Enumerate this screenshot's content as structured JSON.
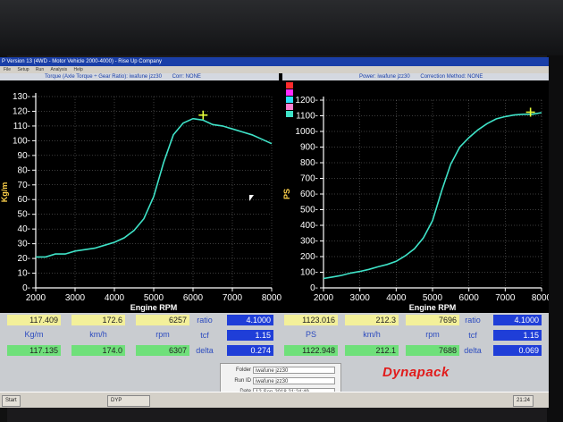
{
  "window": {
    "title": "P Version 13 (4WD - Motor Vehicle 2000-4000) - Rise Up Company",
    "menu": [
      "File",
      "Setup",
      "Run",
      "Analysis",
      "Help"
    ]
  },
  "left_header": {
    "title": "Torque (Axle Torque ÷ Gear Ratio): iwafune jzz30",
    "corr": "Corr: NONE"
  },
  "right_header": {
    "title": "Power: iwafune jzz30",
    "corr": "Correction Method: NONE"
  },
  "chart_data": [
    {
      "type": "line",
      "xlabel": "Engine RPM",
      "ylabel": "Kg/m",
      "xlim": [
        2000,
        8000
      ],
      "ylim": [
        0,
        130
      ],
      "x_ticks": [
        2000,
        3000,
        4000,
        5000,
        6000,
        7000,
        8000
      ],
      "y_ticks": [
        0,
        10,
        20,
        30,
        40,
        50,
        60,
        70,
        80,
        90,
        100,
        110,
        120,
        130
      ],
      "grid": true,
      "series": [
        {
          "color": "#3fe3c8",
          "x": [
            2000,
            2250,
            2500,
            2750,
            3000,
            3250,
            3500,
            3750,
            4000,
            4250,
            4500,
            4750,
            5000,
            5250,
            5500,
            5750,
            6000,
            6250,
            6500,
            6750,
            7000,
            7250,
            7500,
            7750,
            8000
          ],
          "y": [
            21,
            21,
            23,
            23,
            25,
            26,
            27,
            29,
            31,
            34,
            39,
            47,
            62,
            85,
            104,
            112,
            115,
            114,
            111,
            110,
            108,
            106,
            104,
            101,
            98
          ]
        }
      ],
      "marker": {
        "x": 6257,
        "y": 117.4
      }
    },
    {
      "type": "line",
      "xlabel": "Engine RPM",
      "ylabel": "PS",
      "xlim": [
        2000,
        8000
      ],
      "ylim": [
        0,
        1200
      ],
      "x_ticks": [
        2000,
        3000,
        4000,
        5000,
        6000,
        7000,
        8000
      ],
      "y_ticks": [
        0,
        100,
        200,
        300,
        400,
        500,
        600,
        700,
        800,
        900,
        1000,
        1100,
        1200
      ],
      "grid": true,
      "series": [
        {
          "color": "#3fe3c8",
          "x": [
            2000,
            2250,
            2500,
            2750,
            3000,
            3250,
            3500,
            3750,
            4000,
            4250,
            4500,
            4750,
            5000,
            5250,
            5500,
            5750,
            6000,
            6250,
            6500,
            6750,
            7000,
            7250,
            7500,
            7750,
            8000
          ],
          "y": [
            60,
            70,
            80,
            95,
            105,
            118,
            135,
            150,
            170,
            205,
            250,
            320,
            430,
            620,
            790,
            900,
            960,
            1010,
            1050,
            1080,
            1095,
            1105,
            1110,
            1110,
            1120
          ]
        }
      ],
      "marker": {
        "x": 7696,
        "y": 1123
      }
    }
  ],
  "left_panel": {
    "row1": [
      "117.409",
      "172.6",
      "6257"
    ],
    "units": [
      "Kg/m",
      "km/h",
      "rpm"
    ],
    "row2": [
      "117.135",
      "174.0",
      "6307"
    ],
    "labels": [
      "ratio",
      "tcf",
      "delta"
    ],
    "values": [
      "4.1000",
      "1.15",
      "0.274"
    ]
  },
  "right_panel": {
    "row1": [
      "1123.016",
      "212.3",
      "7696"
    ],
    "units": [
      "PS",
      "km/h",
      "rpm"
    ],
    "row2": [
      "1122.948",
      "212.1",
      "7688"
    ],
    "labels": [
      "ratio",
      "tcf",
      "delta"
    ],
    "values": [
      "4.1000",
      "1.15",
      "0.069"
    ]
  },
  "info": {
    "folder_label": "Folder",
    "folder_value": "iwafune jzz30",
    "runid_label": "Run ID",
    "runid_value": "iwafune jzz30",
    "date_label": "Date",
    "date_value": "12-Sep-2018 21:24:49"
  },
  "brand": "Dynapack",
  "taskbar": {
    "start": "Start",
    "app": "DYP",
    "clock": "21:24"
  },
  "colors": {
    "curve": "#3fe3c8",
    "marker": "#e8ff3a",
    "grid": "#ffffff"
  },
  "legend_swatches": [
    "#ff2b2b",
    "#ff2bff",
    "#2be3ff",
    "#ff7fd0",
    "#3fe3c8"
  ]
}
